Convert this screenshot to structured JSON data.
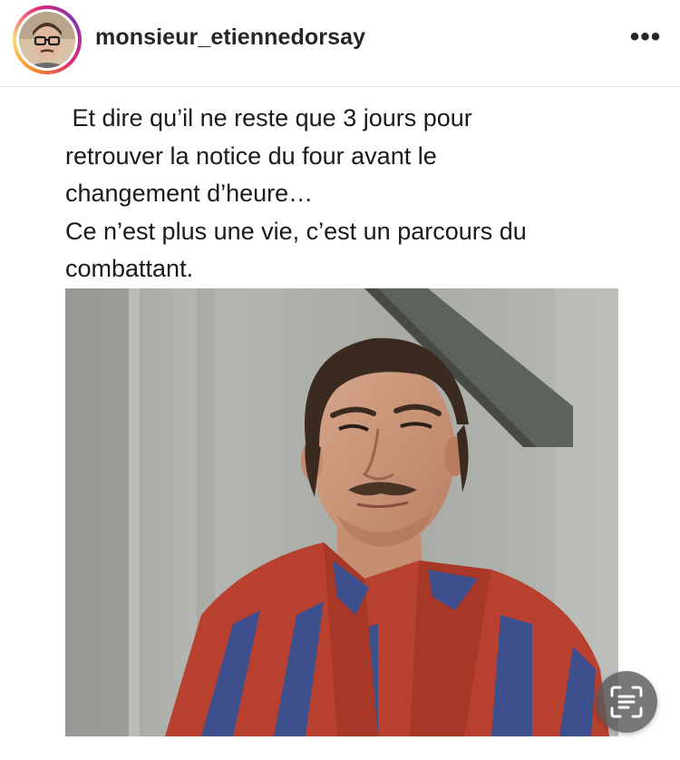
{
  "post": {
    "username": "monsieur_etiennedorsay",
    "more_label": "•••",
    "caption": " Et dire qu’il ne reste que 3 jours pour\nretrouver la notice du four avant le\nchangement d’heure…\nCe n’est plus une vie, c’est un parcours du\ncombattant."
  },
  "icons": {
    "more": "more-options-icon",
    "scan": "live-text-scan-icon"
  },
  "colors": {
    "username": "#262626",
    "caption_text": "#1a1a1a",
    "divider": "#e6e6e6",
    "robe_red": "#b8402f",
    "robe_blue": "#3e4f8e"
  }
}
